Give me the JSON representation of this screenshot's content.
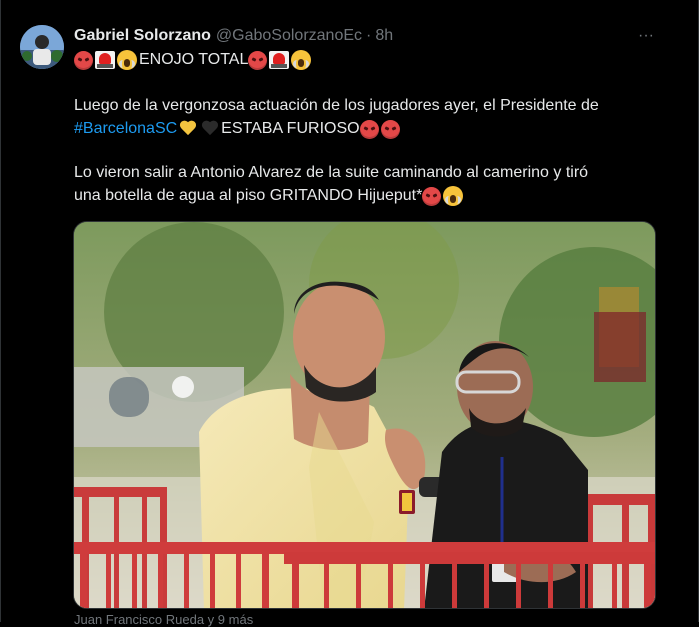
{
  "tweet": {
    "author_name": "Gabriel Solorzano",
    "handle": "@GaboSolorzanoEc",
    "separator": "·",
    "time": "8h",
    "more_label": "···",
    "line1_text": " ENOJO TOTAL ",
    "line2_text": "Luego de la vergonzosa actuación de los jugadores ayer, el Presidente de",
    "line3_hashtag": "#BarcelonaSC",
    "line3_text": " ESTABA FURIOSO ",
    "line4_text": "Lo vieron salir a Antonio Alvarez de la suite caminando al camerino y tiró",
    "line5_text": "una botella de agua al piso GRITANDO Hijueput* ",
    "image_caption": "Juan Francisco Rueda y 9 más"
  },
  "icons": {
    "avatar": "avatar-image",
    "more": "more-icon",
    "emojis": [
      "angry-face-icon",
      "police-light-icon",
      "screaming-face-icon",
      "yellow-heart-icon",
      "black-heart-icon"
    ]
  },
  "colors": {
    "background": "#000000",
    "text": "#e7e9ea",
    "muted": "#71767b",
    "link": "#1d9bf0",
    "border": "#2f3336"
  }
}
